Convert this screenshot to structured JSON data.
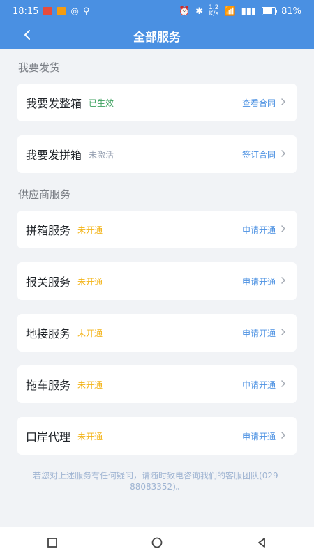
{
  "status_bar": {
    "time": "18:15",
    "network_speed_top": "1.2",
    "network_speed_bottom": "K/s",
    "battery": "81%"
  },
  "header": {
    "title": "全部服务"
  },
  "sections": {
    "shipping_title": "我要发货",
    "supplier_title": "供应商服务"
  },
  "shipping": [
    {
      "title": "我要发整箱",
      "status": "已生效",
      "action": "查看合同"
    },
    {
      "title": "我要发拼箱",
      "status": "未激活",
      "action": "签订合同"
    }
  ],
  "supplier": [
    {
      "title": "拼箱服务",
      "status": "未开通",
      "action": "申请开通"
    },
    {
      "title": "报关服务",
      "status": "未开通",
      "action": "申请开通"
    },
    {
      "title": "地接服务",
      "status": "未开通",
      "action": "申请开通"
    },
    {
      "title": "拖车服务",
      "status": "未开通",
      "action": "申请开通"
    },
    {
      "title": "口岸代理",
      "status": "未开通",
      "action": "申请开通"
    }
  ],
  "footer_note": "若您对上述服务有任何疑问，请随时致电咨询我们的客服团队(029-88083352)。",
  "icons": {
    "back": "back-arrow-icon",
    "chevron": "chevron-right-icon",
    "nav_square": "square-icon",
    "nav_circle": "circle-icon",
    "nav_back": "triangle-left-icon"
  }
}
